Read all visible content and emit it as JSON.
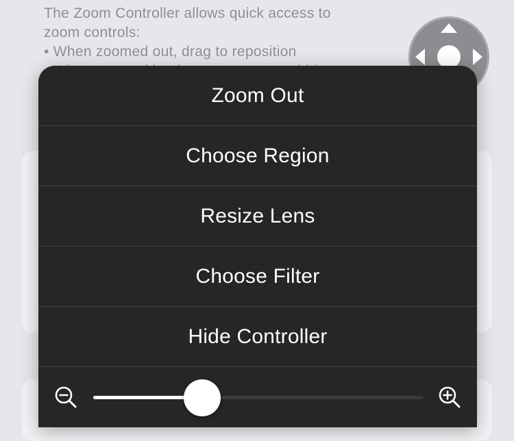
{
  "background": {
    "description_lines": [
      "The Zoom Controller allows quick access to",
      "zoom controls:",
      "• When zoomed out, drag to reposition",
      "• When zoomed in, drag to pan; tap to hide"
    ],
    "joystick_icon": "directional-pad-icon"
  },
  "menu": {
    "items": [
      {
        "label": "Zoom Out"
      },
      {
        "label": "Choose Region"
      },
      {
        "label": "Resize Lens"
      },
      {
        "label": "Choose Filter"
      },
      {
        "label": "Hide Controller"
      }
    ],
    "zoom_slider": {
      "value_fraction": 0.33,
      "min_icon": "zoom-out-icon",
      "max_icon": "zoom-in-icon"
    }
  },
  "colors": {
    "menu_background": "#262626",
    "menu_text": "#ffffff",
    "separator": "#444446",
    "page_background": "#e7e7eb"
  }
}
